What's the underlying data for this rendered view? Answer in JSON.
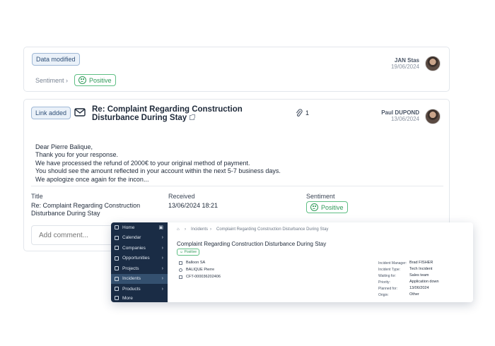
{
  "card1": {
    "badge": "Data modified",
    "user_name": "JAN Stas",
    "date": "19/06/2024",
    "sentiment_label": "Sentiment",
    "sentiment_value": "Positive"
  },
  "card2": {
    "badge": "Link added",
    "subject": "Re: Complaint Regarding Construction Disturbance During Stay",
    "attachment_count": "1",
    "user_name": "Paul DUPOND",
    "date": "13/06/2024",
    "body_lines": [
      "Dear Pierre Balique,",
      "Thank you for your response.",
      "We have processed the refund of 2000€ to your original method of payment.",
      "You should see the amount reflected in your account within the next 5-7 business days.",
      "We apologize once again for the incon..."
    ],
    "fields": {
      "title_label": "Title",
      "title_value": "Re: Complaint Regarding Construction Disturbance During Stay",
      "received_label": "Received",
      "received_value": "13/06/2024 18:21",
      "sentiment_label": "Sentiment",
      "sentiment_value": "Positive"
    },
    "comment_placeholder": "Add comment..."
  },
  "app": {
    "nav": [
      "Home",
      "Calendar",
      "Companies",
      "Opportunities",
      "Projects",
      "Incidents",
      "Products",
      "More"
    ],
    "active_nav": "Incidents",
    "breadcrumb": [
      "Incidents",
      "Complaint Regarding Construction Disturbance During Stay"
    ],
    "title": "Complaint Regarding Construction Disturbance During Stay",
    "sentiment": "Positive",
    "company": "Balloon SA",
    "contact": "BALIQUE Pierre",
    "reference": "CFT-000036202406",
    "details": [
      {
        "key": "Incident Manager:",
        "value": "Brad FISHER"
      },
      {
        "key": "Incident Type:",
        "value": "Tech Incident"
      },
      {
        "key": "Waiting for:",
        "value": "Sales team"
      },
      {
        "key": "Priority:",
        "value": "Application down"
      },
      {
        "key": "Planned for:",
        "value": "13/06/2024"
      },
      {
        "key": "Origin:",
        "value": "Other"
      }
    ]
  },
  "colors": {
    "accent_green": "#2f9a58",
    "badge_blue": "#2f4f77",
    "sidebar": "#1a2c45"
  }
}
